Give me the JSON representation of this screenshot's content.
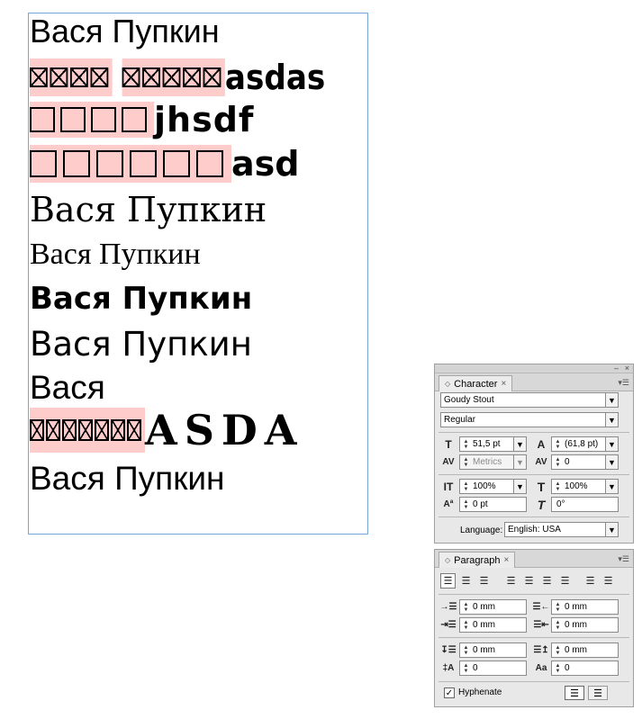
{
  "document": {
    "lines": [
      {
        "text": "Вася Пупкин"
      },
      {
        "missing_a": "▯▯▯▯",
        "missing_b": "▯▯▯▯▯",
        "text": "asdas"
      },
      {
        "missing": "□□□□",
        "text": "jhsdf"
      },
      {
        "missing": "□□□□□□",
        "text": "asd"
      },
      {
        "text": "Вася Пупкин"
      },
      {
        "text": "Вася Пупкин"
      },
      {
        "text": "Вася Пупкин"
      },
      {
        "text": "Вася Пупкин"
      },
      {
        "text": "Вася"
      },
      {
        "missing": "▯▯▯▯▯▯▯",
        "text": "ASDA"
      },
      {
        "text": "Вася Пупкин"
      }
    ],
    "missing_glyph_highlight": "#ffcccc",
    "frame_border": "#79a6da"
  },
  "character_panel": {
    "tab_label": "Character",
    "font_family": "Goudy Stout",
    "font_style": "Regular",
    "font_size": "51,5 pt",
    "leading": "(61,8 pt)",
    "kerning": "Metrics",
    "tracking": "0",
    "vertical_scale": "100%",
    "horizontal_scale": "100%",
    "baseline_shift": "0 pt",
    "skew": "0°",
    "language_label": "Language:",
    "language": "English: USA"
  },
  "paragraph_panel": {
    "tab_label": "Paragraph",
    "left_indent": "0 mm",
    "right_indent": "0 mm",
    "first_line_indent": "0 mm",
    "last_line_indent": "0 mm",
    "space_before": "0 mm",
    "space_after": "0 mm",
    "drop_cap_lines": "0",
    "drop_cap_chars": "0",
    "hyphenate_label": "Hyphenate",
    "hyphenate_checked": true
  }
}
